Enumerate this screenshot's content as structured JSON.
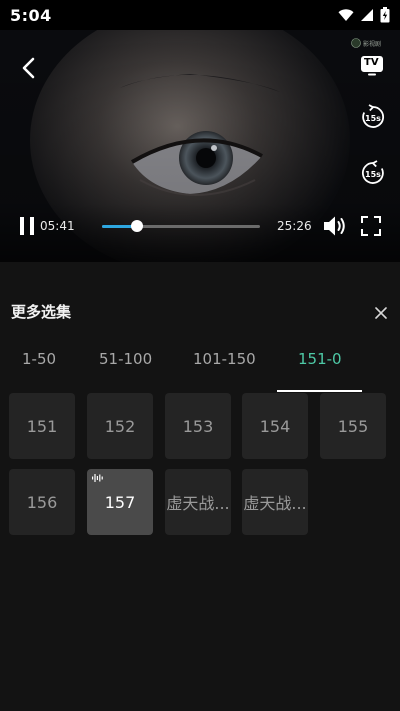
{
  "status_bar": {
    "time": "5:04"
  },
  "player": {
    "watermark": "影视剧",
    "tv_label": "TV",
    "rewind_label": "15s",
    "forward_label": "15s",
    "current_time": "05:41",
    "total_time": "25:26",
    "progress": 0.22,
    "accent_color": "#2ea7e0"
  },
  "panel": {
    "title": "更多选集",
    "tabs": [
      {
        "label": "1-50"
      },
      {
        "label": "51-100"
      },
      {
        "label": "101-150"
      },
      {
        "label": "151-0"
      }
    ],
    "active_tab_color": "#4ec9a6",
    "episodes": [
      {
        "label": "151"
      },
      {
        "label": "152"
      },
      {
        "label": "153"
      },
      {
        "label": "154"
      },
      {
        "label": "155"
      },
      {
        "label": "156"
      },
      {
        "label": "157",
        "playing": true
      },
      {
        "label": "虚天战..."
      },
      {
        "label": "虚天战..."
      }
    ]
  },
  "icons": [
    "back-arrow-icon",
    "tv-cast-icon",
    "rewind-15-icon",
    "forward-15-icon",
    "pause-icon",
    "volume-icon",
    "fullscreen-icon",
    "close-icon",
    "wifi-icon",
    "signal-icon",
    "battery-icon",
    "playing-bars-icon"
  ]
}
